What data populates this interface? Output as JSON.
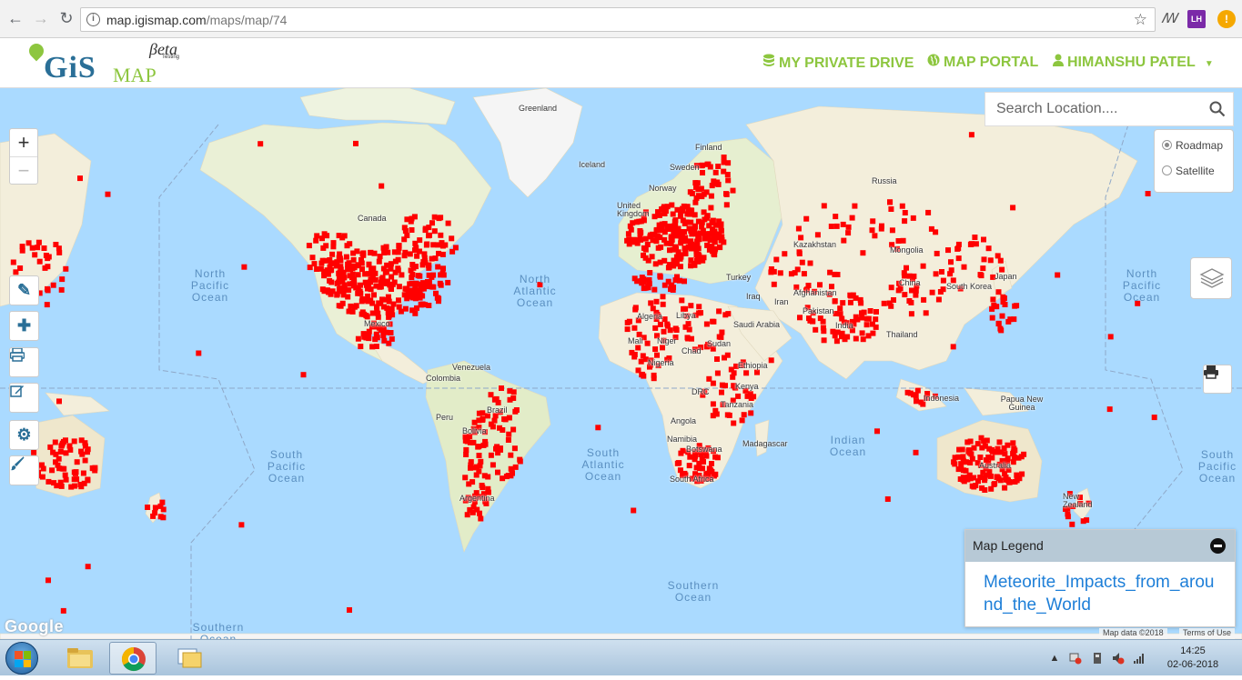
{
  "browser": {
    "url_host": "map.igismap.com",
    "url_path": "/maps/map/74",
    "back_icon": "arrow-left-icon",
    "forward_icon": "arrow-right-icon",
    "reload_icon": "reload-icon",
    "bookmark_icon": "star-icon",
    "extensions": [
      {
        "name": "signature-icon",
        "label": "ꟿ"
      },
      {
        "name": "lh-extension-icon",
        "label": "LH"
      },
      {
        "name": "warning-extension-icon",
        "label": "!"
      }
    ]
  },
  "header": {
    "logo_main": "GiS",
    "logo_map": "MAP",
    "logo_beta": "βeta",
    "logo_testing": "Testing",
    "nav": [
      {
        "id": "private-drive",
        "label": "MY PRIVATE DRIVE",
        "icon": "database-icon"
      },
      {
        "id": "map-portal",
        "label": "MAP PORTAL",
        "icon": "globe-icon"
      },
      {
        "id": "user-menu",
        "label": "HIMANSHU PATEL",
        "icon": "user-icon"
      }
    ],
    "accent_color": "#8dc63f"
  },
  "map": {
    "search_placeholder": "Search Location....",
    "basemap_options": [
      {
        "label": "Roadmap",
        "selected": true
      },
      {
        "label": "Satellite",
        "selected": false
      }
    ],
    "zoom_in": "+",
    "zoom_out": "−",
    "tools": [
      "pencil-icon",
      "plus-icon",
      "print-icon",
      "edit-icon",
      "settings-icon",
      "brush-icon"
    ],
    "ocean_labels": [
      {
        "id": "north-pacific-w",
        "text": "North Pacific Ocean"
      },
      {
        "id": "north-atlantic",
        "text": "North Atlantic Ocean"
      },
      {
        "id": "north-pacific-e",
        "text": "North Pacific Ocean"
      },
      {
        "id": "south-pacific-w",
        "text": "South Pacific Ocean"
      },
      {
        "id": "south-atlantic",
        "text": "South Atlantic Ocean"
      },
      {
        "id": "indian",
        "text": "Indian Ocean"
      },
      {
        "id": "south-pacific-e",
        "text": "South Pacific Ocean"
      },
      {
        "id": "southern-1",
        "text": "Southern Ocean"
      },
      {
        "id": "southern-2",
        "text": "Southern Ocean"
      }
    ],
    "country_labels": [
      "Greenland",
      "Iceland",
      "Finland",
      "Sweden",
      "Norway",
      "United Kingdom",
      "Russia",
      "Kazakhstan",
      "Mongolia",
      "China",
      "Japan",
      "South Korea",
      "Canada",
      "Turkey",
      "Iraq",
      "Iran",
      "Afghanistan",
      "Pakistan",
      "India",
      "Thailand",
      "Saudi Arabia",
      "Libya",
      "Algeria",
      "Mali",
      "Niger",
      "Chad",
      "Sudan",
      "Ethiopia",
      "Nigeria",
      "DRC",
      "Kenya",
      "Tanzania",
      "Angola",
      "Namibia",
      "Botswana",
      "South Africa",
      "Madagascar",
      "Indonesia",
      "Papua New Guinea",
      "Australia",
      "New Zealand",
      "Venezuela",
      "Colombia",
      "Peru",
      "Brazil",
      "Bolivia",
      "Argentina",
      "Mexico"
    ],
    "legend": {
      "title": "Map Legend",
      "layer_name": "Meteorite_Impacts_from_around_the_World",
      "marker_color": "#ff0000"
    },
    "google": "Google",
    "attribution_data": "Map data ©2018",
    "attribution_terms": "Terms of Use"
  },
  "taskbar": {
    "time": "14:25",
    "date": "02-06-2018"
  }
}
